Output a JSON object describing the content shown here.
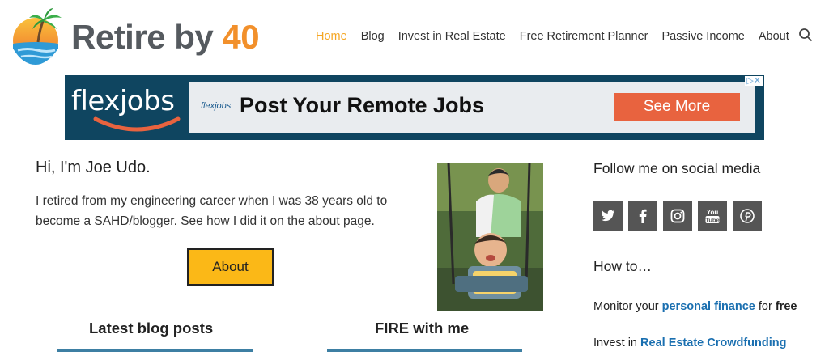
{
  "header": {
    "logo": {
      "word": "Retire by ",
      "number": "40"
    },
    "nav": [
      {
        "label": "Home",
        "active": true
      },
      {
        "label": "Blog",
        "active": false
      },
      {
        "label": "Invest in Real Estate",
        "active": false
      },
      {
        "label": "Free Retirement Planner",
        "active": false
      },
      {
        "label": "Passive Income",
        "active": false
      },
      {
        "label": "About",
        "active": false
      }
    ],
    "search_icon": "search-icon",
    "active_color": "#f5a623"
  },
  "ad": {
    "brand": "flexjobs",
    "small_logo": "flexjobs",
    "headline": "Post Your Remote Jobs",
    "cta": "See More",
    "cta_color": "#e8633f",
    "background_color": "#0f4560"
  },
  "intro": {
    "greeting": "Hi, I'm Joe Udo.",
    "body": "I retired from my engineering career when I was 38 years old to become a SAHD/blogger. See how I did it on the about page.",
    "button": "About",
    "button_color": "#fbb817"
  },
  "sections": {
    "latest": "Latest blog posts",
    "fire": "FIRE with me"
  },
  "sidebar": {
    "follow_title": "Follow me on social media",
    "social": [
      "twitter-icon",
      "facebook-icon",
      "instagram-icon",
      "youtube-icon",
      "pinterest-icon"
    ],
    "howto_title": "How to…",
    "links": [
      {
        "prefix": "Monitor your ",
        "link": "personal finance",
        "middle": " for ",
        "suffix": "free"
      },
      {
        "prefix": "Invest in ",
        "link": "Real Estate Crowdfunding",
        "middle": "",
        "suffix": ""
      }
    ],
    "link_color": "#1a6fb0"
  }
}
